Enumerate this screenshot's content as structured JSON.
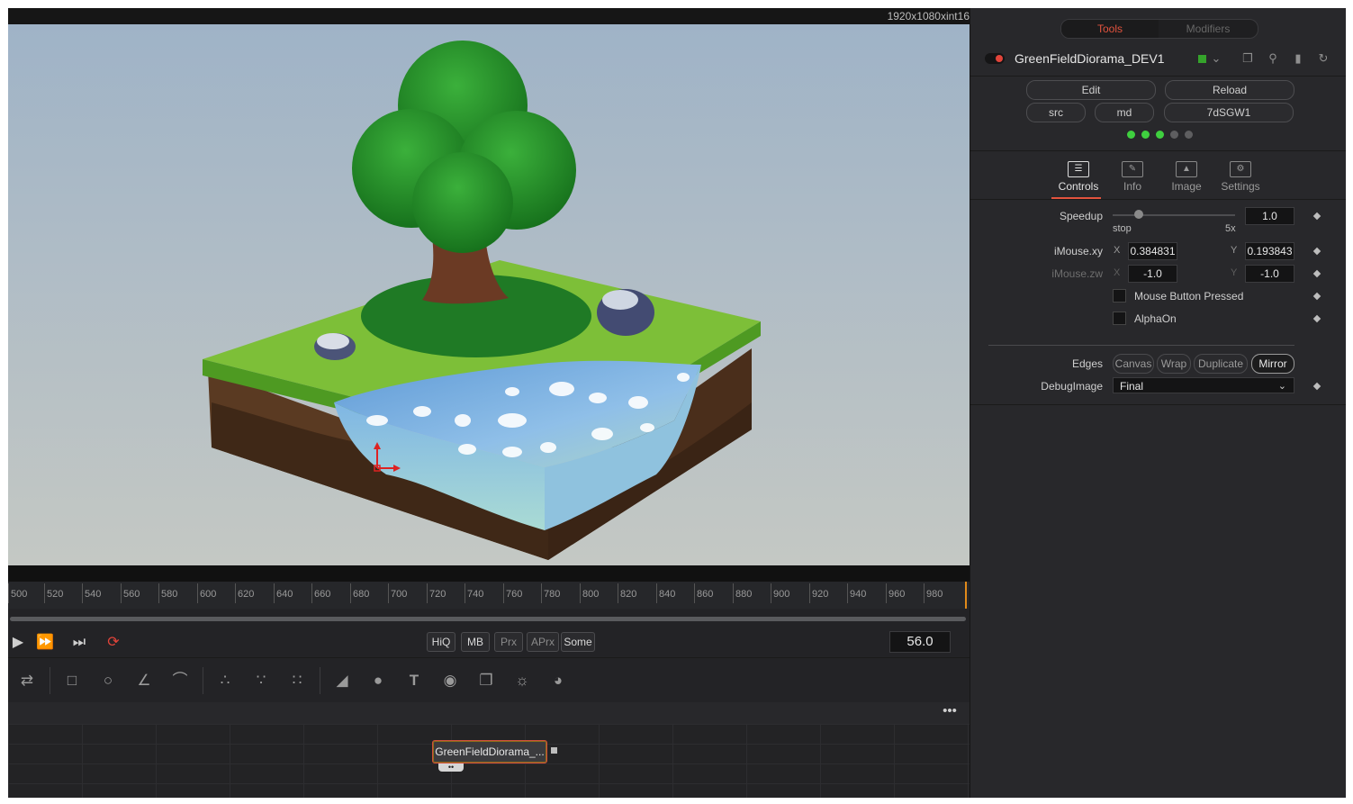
{
  "viewer": {
    "resolution": "1920x1080xint16"
  },
  "timeline": {
    "ruler_ticks": [
      "500",
      "520",
      "540",
      "560",
      "580",
      "600",
      "620",
      "640",
      "660",
      "680",
      "700",
      "720",
      "740",
      "760",
      "780",
      "800",
      "820",
      "840",
      "860",
      "880",
      "900",
      "920",
      "940",
      "960",
      "980"
    ],
    "current_frame": "56.0"
  },
  "transport": {
    "play_icon": "play-icon",
    "ff_icon": "fast-forward-icon",
    "end_icon": "skip-to-end-icon",
    "loop_icon": "loop-icon",
    "loop_color": "#e2443a",
    "quality_buttons": [
      {
        "label": "HiQ"
      },
      {
        "label": "MB"
      },
      {
        "label": "Prx"
      },
      {
        "label": "APrx"
      },
      {
        "label": "Some"
      }
    ]
  },
  "node_graph": {
    "node_label": "GreenFieldDiorama_...",
    "more_label": "•••"
  },
  "inspector": {
    "tabs": {
      "tools": "Tools",
      "modifiers": "Modifiers"
    },
    "tool_name": "GreenFieldDiorama_DEV1",
    "buttons": {
      "edit": "Edit",
      "reload": "Reload",
      "src": "src",
      "md": "md",
      "hash": "7dSGW1"
    },
    "status_dots": [
      "#3fcf3f",
      "#3fcf3f",
      "#3fcf3f",
      "#5e5e60",
      "#5e5e60"
    ],
    "inspector_tabs": [
      "Controls",
      "Info",
      "Image",
      "Settings"
    ],
    "speedup": {
      "label": "Speedup",
      "value": "1.0",
      "min_label": "stop",
      "max_label": "5x"
    },
    "imouse_xy": {
      "label": "iMouse.xy",
      "x_axis": "X",
      "x": "0.384831",
      "y_axis": "Y",
      "y": "0.193843"
    },
    "imouse_zw": {
      "label": "iMouse.zw",
      "x_axis": "X",
      "x": "-1.0",
      "y_axis": "Y",
      "y": "-1.0"
    },
    "mouse_button": {
      "label": "Mouse Button Pressed"
    },
    "alpha_on": {
      "label": "AlphaOn"
    },
    "edges": {
      "label": "Edges",
      "options": [
        "Canvas",
        "Wrap",
        "Duplicate",
        "Mirror"
      ],
      "selected": "Mirror"
    },
    "debug_image": {
      "label": "DebugImage",
      "value": "Final"
    },
    "accent": "#e2533e"
  }
}
